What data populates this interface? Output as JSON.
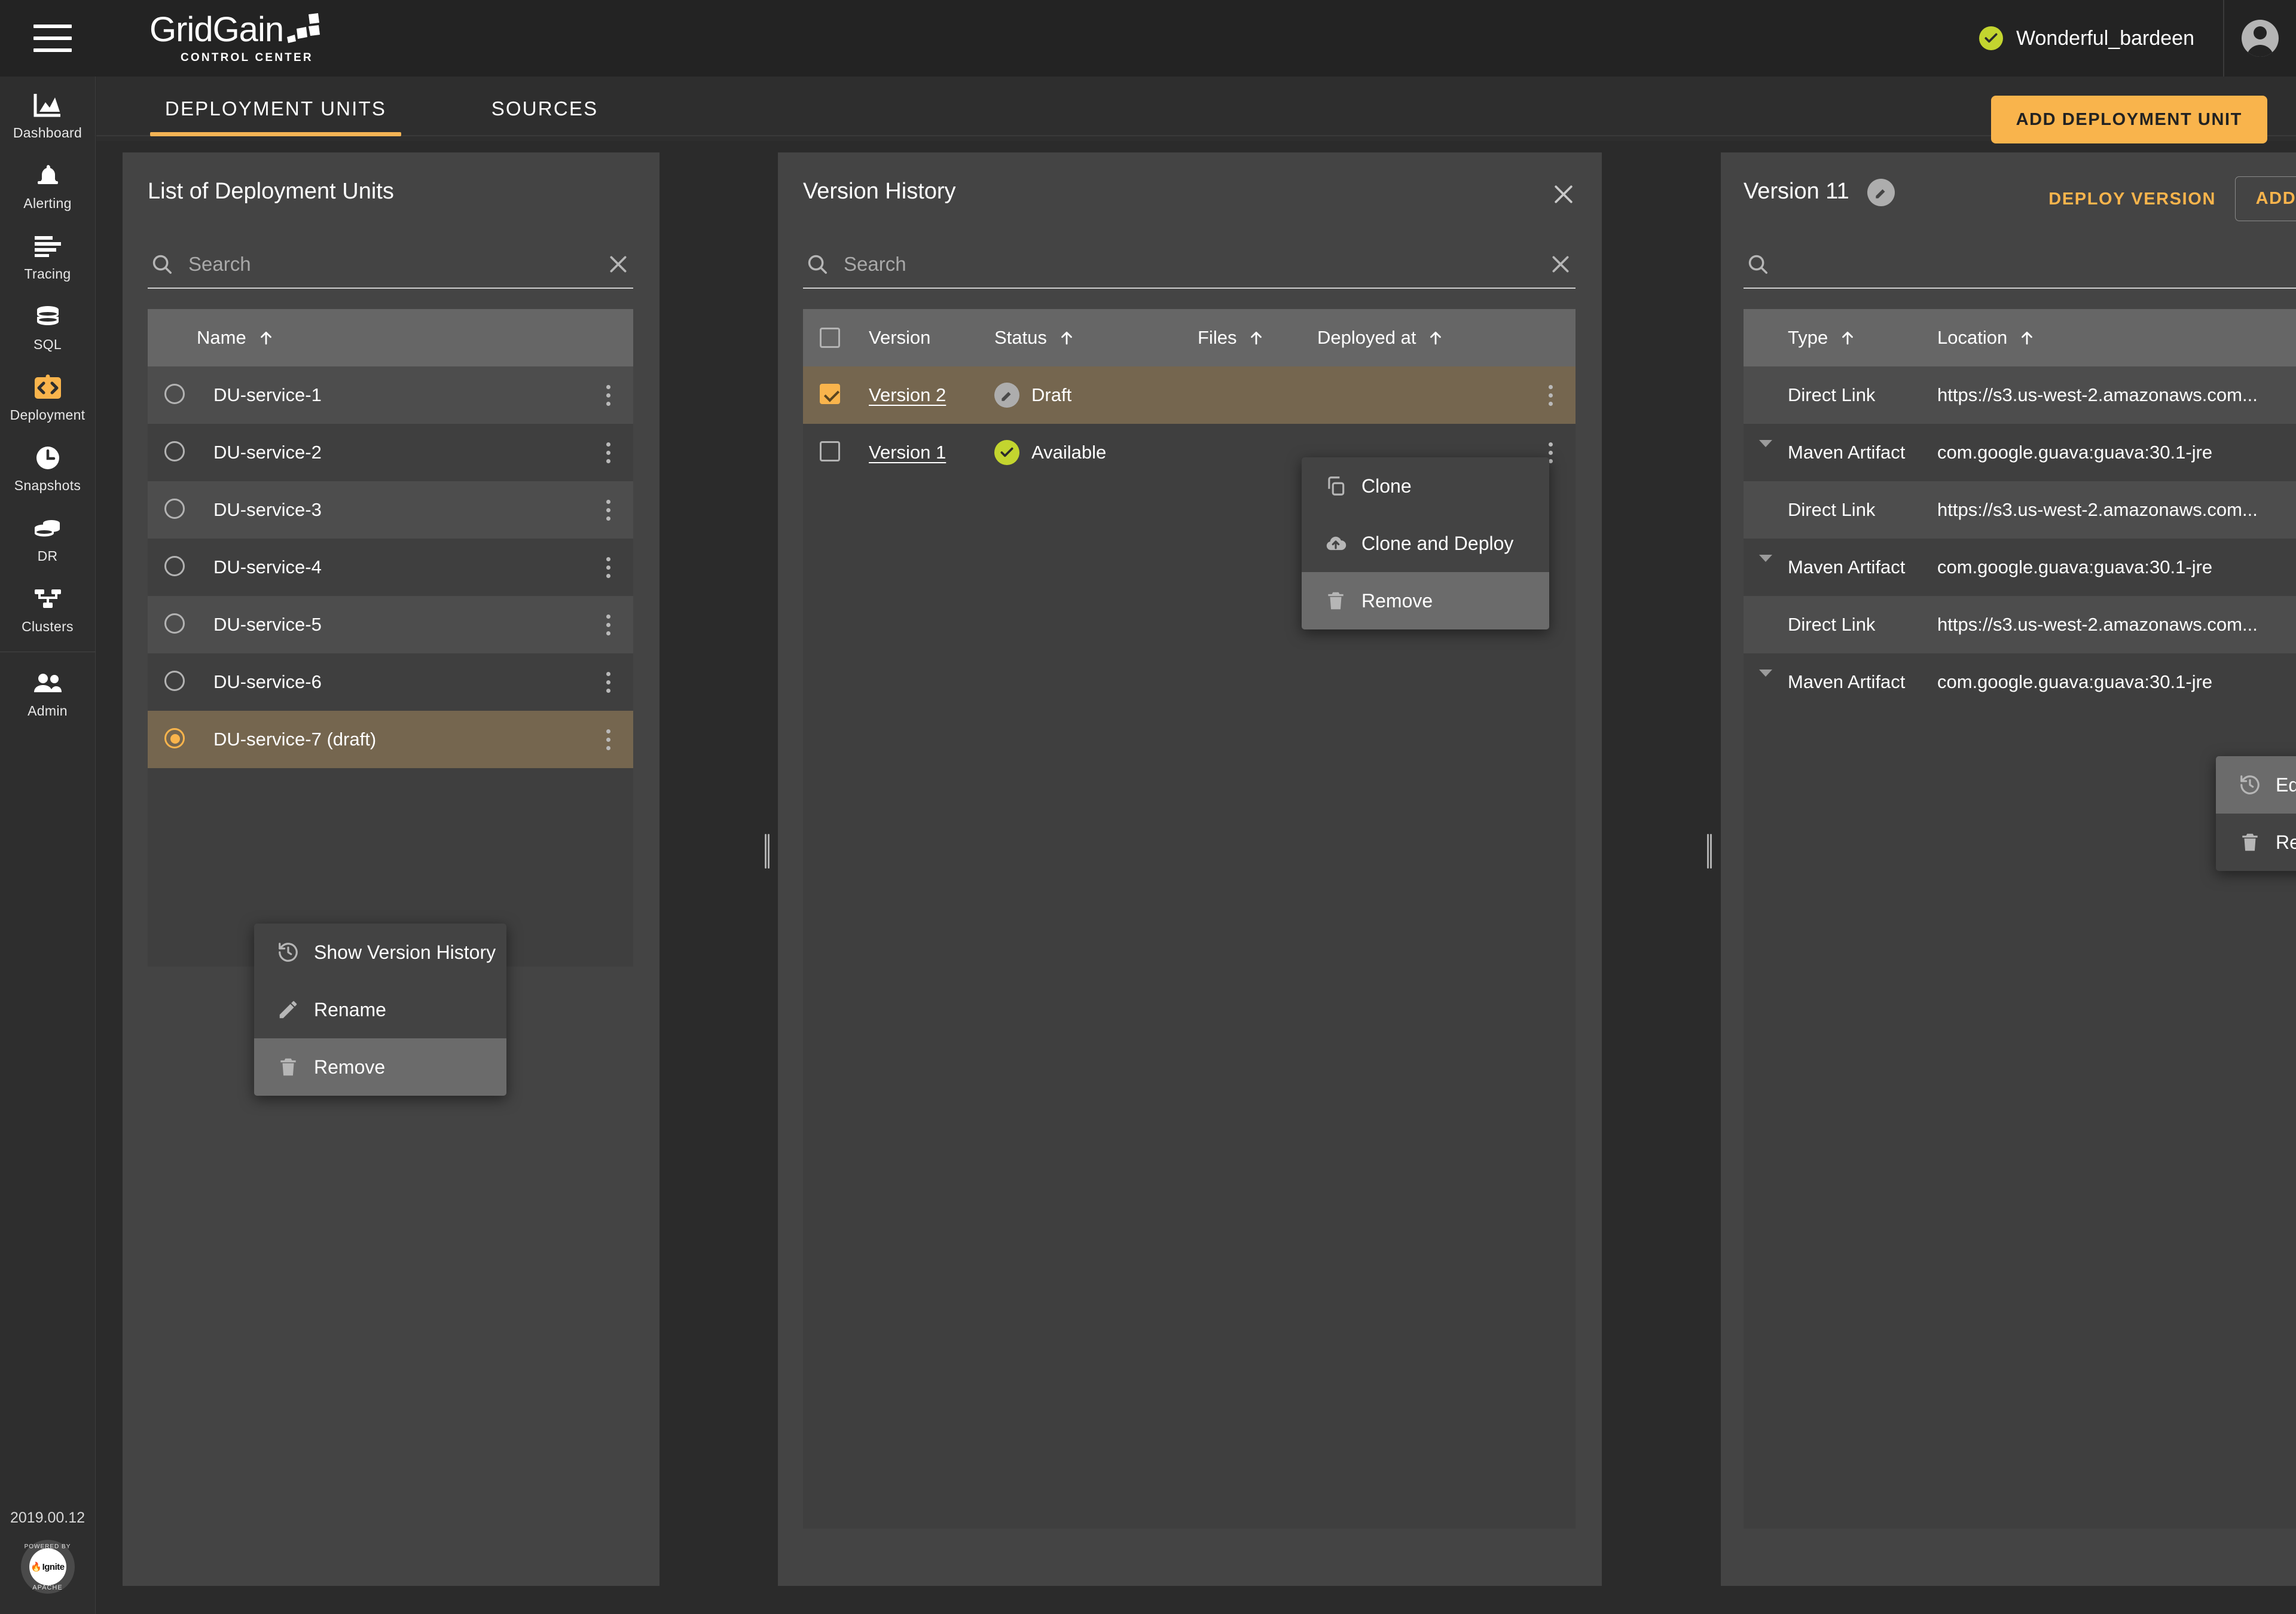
{
  "topbar": {
    "menu_icon": "hamburger-icon",
    "brand_name": "GridGain",
    "brand_sub": "CONTROL CENTER",
    "cluster_status_icon": "check-circle-icon",
    "cluster_name": "Wonderful_bardeen",
    "avatar_icon": "user-avatar-icon"
  },
  "sidebar": {
    "items": [
      {
        "label": "Dashboard",
        "icon": "chart-area-icon",
        "active": false
      },
      {
        "label": "Alerting",
        "icon": "bell-icon",
        "active": false
      },
      {
        "label": "Tracing",
        "icon": "lines-icon",
        "active": false
      },
      {
        "label": "SQL",
        "icon": "database-icon",
        "active": false
      },
      {
        "label": "Deployment",
        "icon": "code-brackets-icon",
        "active": true
      },
      {
        "label": "Snapshots",
        "icon": "clock-icon",
        "active": false
      },
      {
        "label": "DR",
        "icon": "disks-icon",
        "active": false
      },
      {
        "label": "Clusters",
        "icon": "topology-icon",
        "active": false
      },
      {
        "label": "Admin",
        "icon": "users-icon",
        "active": false
      }
    ],
    "version": "2019.00.12",
    "powered_top": "POWERED BY",
    "powered_bottom": "APACHE",
    "powered_brand": "Ignite",
    "powered_brand_small": "apache"
  },
  "tabs": [
    {
      "label": "DEPLOYMENT UNITS",
      "active": true
    },
    {
      "label": "SOURCES",
      "active": false
    }
  ],
  "add_deployment_unit_button": "ADD DEPLOYMENT UNIT",
  "left_panel": {
    "title": "List of Deployment Units",
    "search": {
      "value": "",
      "placeholder": "Search",
      "icon": "search-icon",
      "clear_icon": "close-icon"
    },
    "column_header": {
      "label": "Name",
      "sort_icon": "sort-asc-icon"
    },
    "rows": [
      {
        "name": "DU-service-1",
        "selected": false
      },
      {
        "name": "DU-service-2",
        "selected": false
      },
      {
        "name": "DU-service-3",
        "selected": false
      },
      {
        "name": "DU-service-4",
        "selected": false
      },
      {
        "name": "DU-service-5",
        "selected": false
      },
      {
        "name": "DU-service-6",
        "selected": false
      },
      {
        "name": "DU-service-7 (draft)",
        "selected": true
      }
    ],
    "context_menu": {
      "items": [
        {
          "label": "Show Version History",
          "icon": "history-icon",
          "highlighted": false
        },
        {
          "label": "Rename",
          "icon": "pencil-icon",
          "highlighted": false
        },
        {
          "label": "Remove",
          "icon": "trash-icon",
          "highlighted": true
        }
      ]
    }
  },
  "middle_panel": {
    "title": "Version History",
    "close_icon": "close-icon",
    "search": {
      "value": "",
      "placeholder": "Search",
      "icon": "search-icon",
      "clear_icon": "close-icon"
    },
    "columns": [
      {
        "label": "Version",
        "sort": false
      },
      {
        "label": "Status",
        "sort": true
      },
      {
        "label": "Files",
        "sort": true
      },
      {
        "label": "Deployed at",
        "sort": true
      }
    ],
    "rows": [
      {
        "version": "Version 2",
        "status": "Draft",
        "status_icon": "draft-icon",
        "files": "",
        "deployed_at": "",
        "checked": true,
        "selected": true
      },
      {
        "version": "Version 1",
        "status": "Available",
        "status_icon": "check-icon",
        "files": "",
        "deployed_at": "",
        "checked": false,
        "selected": false
      }
    ],
    "context_menu": {
      "items": [
        {
          "label": "Clone",
          "icon": "copy-icon",
          "highlighted": false
        },
        {
          "label": "Clone and Deploy",
          "icon": "cloud-upload-icon",
          "highlighted": false
        },
        {
          "label": "Remove",
          "icon": "trash-icon",
          "highlighted": true
        }
      ]
    }
  },
  "right_panel": {
    "title": "Version 11",
    "edit_icon": "edit-circle-icon",
    "deploy_button": "DEPLOY VERSION",
    "add_artifact_button": "ADD ARTIFACT",
    "search": {
      "value": "",
      "placeholder": "",
      "icon": "search-icon",
      "clear_icon": "close-icon"
    },
    "columns": [
      {
        "label": "Type",
        "sort": true
      },
      {
        "label": "Location",
        "sort": true
      }
    ],
    "rows": [
      {
        "type": "Direct Link",
        "location": "https://s3.us-west-2.amazonaws.com...",
        "expandable": false
      },
      {
        "type": "Maven Artifact",
        "location": "com.google.guava:guava:30.1-jre",
        "expandable": true
      },
      {
        "type": "Direct Link",
        "location": "https://s3.us-west-2.amazonaws.com...",
        "expandable": false
      },
      {
        "type": "Maven Artifact",
        "location": "com.google.guava:guava:30.1-jre",
        "expandable": true
      },
      {
        "type": "Direct Link",
        "location": "https://s3.us-west-2.amazonaws.com...",
        "expandable": false
      },
      {
        "type": "Maven Artifact",
        "location": "com.google.guava:guava:30.1-jre",
        "expandable": true
      }
    ],
    "context_menu": {
      "items": [
        {
          "label": "Edit Artifact",
          "icon": "history-icon",
          "highlighted": true
        },
        {
          "label": "Remove",
          "icon": "trash-icon",
          "highlighted": false
        }
      ]
    }
  },
  "colors": {
    "accent": "#f9b44c",
    "selected_row": "#75664f",
    "status_ok": "#c3d52f",
    "panel_bg": "#444444",
    "app_bg": "#2b2b2b"
  }
}
